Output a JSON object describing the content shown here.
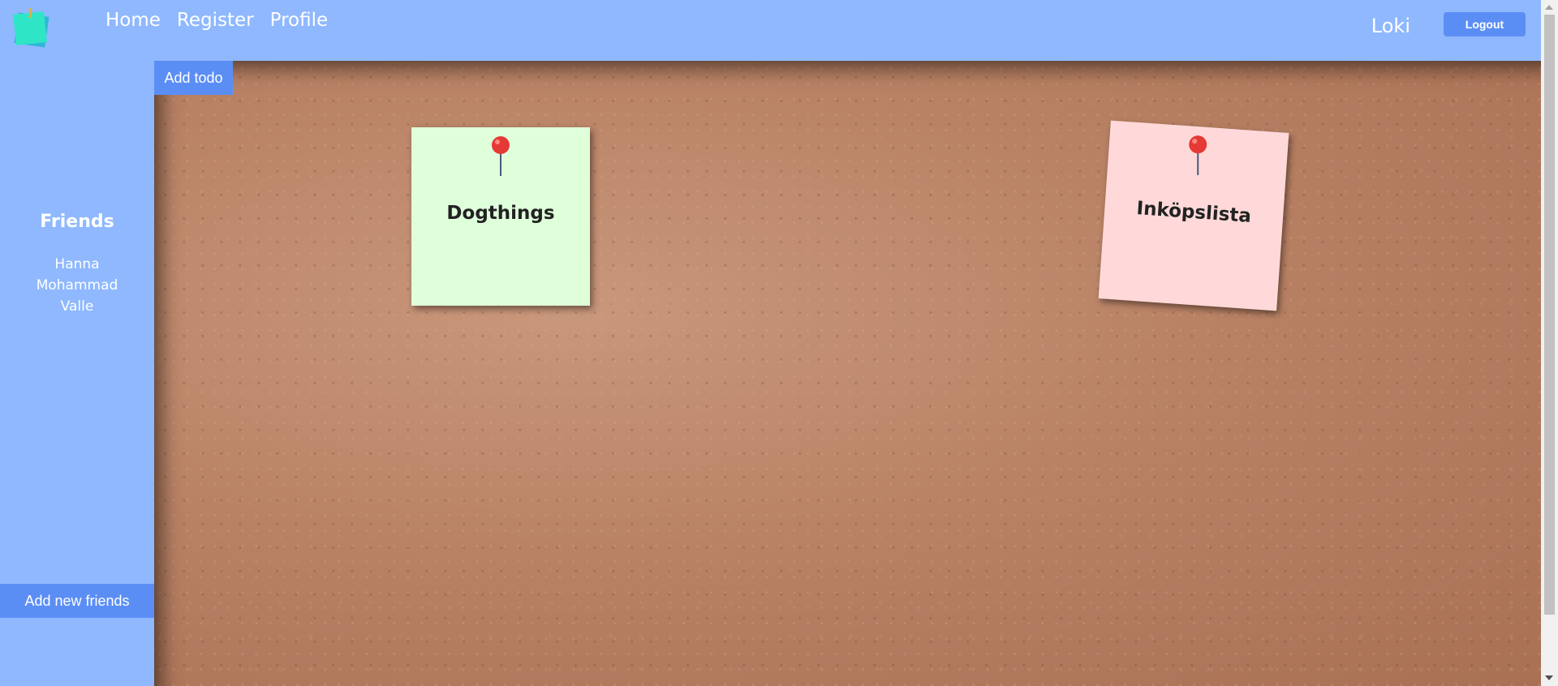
{
  "nav": {
    "links": [
      "Home",
      "Register",
      "Profile"
    ],
    "username": "Loki",
    "logout_label": "Logout"
  },
  "board": {
    "add_todo_label": "Add todo",
    "notes": [
      {
        "title": "Dogthings",
        "color": "#dfffdb"
      },
      {
        "title": "Inköpslista",
        "color": "#ffd9d9"
      }
    ]
  },
  "sidebar": {
    "friends_title": "Friends",
    "friends": [
      "Hanna",
      "Mohammad",
      "Valle"
    ],
    "add_friends_label": "Add new friends"
  },
  "colors": {
    "accent": "#5b8ef5",
    "background": "#8fb8ff",
    "pin": "#e53935"
  },
  "icons": {
    "logo": "sticky-note-logo-icon",
    "pin": "push-pin-icon"
  }
}
